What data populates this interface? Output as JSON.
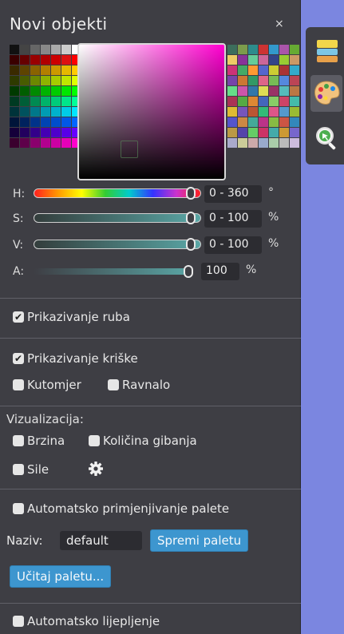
{
  "window": {
    "title": "Novi objekti",
    "close_glyph": "×"
  },
  "palette": {
    "left": [
      "#111111",
      "#444444",
      "#666666",
      "#888888",
      "#aaaaaa",
      "#cccccc",
      "#ffffff",
      "#3a0000",
      "#660000",
      "#990000",
      "#b00000",
      "#cc0000",
      "#dd1111",
      "#ff0000",
      "#3a2a00",
      "#5e4400",
      "#8a6300",
      "#b37f00",
      "#cc9900",
      "#e6b800",
      "#ffcc00",
      "#2e3a00",
      "#485c00",
      "#6b8800",
      "#8fb300",
      "#a6cc00",
      "#bfe600",
      "#ddff00",
      "#003a00",
      "#005e00",
      "#008a00",
      "#00b300",
      "#00cc00",
      "#00e600",
      "#00ff00",
      "#003a22",
      "#005e37",
      "#008a52",
      "#00b36a",
      "#00cc7a",
      "#00e68a",
      "#00ff99",
      "#00333a",
      "#00525e",
      "#00788a",
      "#009cb3",
      "#00b3cc",
      "#00cce6",
      "#00e6ff",
      "#00153a",
      "#00225e",
      "#00338a",
      "#0044b3",
      "#004ecc",
      "#0058e6",
      "#0066ff",
      "#15003a",
      "#22005e",
      "#33008a",
      "#4400b3",
      "#4e00cc",
      "#5800e6",
      "#6600ff",
      "#3a002e",
      "#5e004a",
      "#8a006d",
      "#b3008f",
      "#cc00a3",
      "#e600b8",
      "#ff00cc"
    ],
    "right": [
      "#3c6e5c",
      "#7c9c4c",
      "#2d8c8c",
      "#cc3333",
      "#3399cc",
      "#aa55aa",
      "#66aa33",
      "#eecc66",
      "#883399",
      "#66cc99",
      "#cc6699",
      "#334488",
      "#99cc33",
      "#cc9966",
      "#cc3377",
      "#44aa66",
      "#ff9933",
      "#5566cc",
      "#cccc33",
      "#aa3333",
      "#33aacc",
      "#7744aa",
      "#cc7733",
      "#339966",
      "#dd6688",
      "#77bb55",
      "#5588dd",
      "#bb4455",
      "#66dd88",
      "#cc55aa",
      "#3377aa",
      "#dddd55",
      "#993366",
      "#55bbbb",
      "#bb7744",
      "#aa3355",
      "#55aa44",
      "#dd8833",
      "#4466bb",
      "#88cc66",
      "#cc4466",
      "#44bbaa",
      "#ddbb33",
      "#7755bb",
      "#bb5533",
      "#33bb77",
      "#dd5588",
      "#5599cc",
      "#99bb33",
      "#5555cc",
      "#cc8844",
      "#44aa99",
      "#bb3388",
      "#88bb44",
      "#cc5544",
      "#3388bb",
      "#bb9944",
      "#5544aa",
      "#66cc66",
      "#cc3366",
      "#44aaaa",
      "#cc9933",
      "#7766cc",
      "#aaaacc",
      "#cccc99",
      "#ccaaaa",
      "#99aacc",
      "#aaccaa",
      "#bbbbbb",
      "#ccbbdd"
    ],
    "picker_hue_color": "#ff00d0"
  },
  "sliders": {
    "h": {
      "label": "H:",
      "range": "0 - 360",
      "unit": "°",
      "level": 0.97
    },
    "s": {
      "label": "S:",
      "range": "0 - 100",
      "unit": "%",
      "level": 0.97
    },
    "v": {
      "label": "V:",
      "range": "0 - 100",
      "unit": "%",
      "level": 0.97
    },
    "a": {
      "label": "A:",
      "value": "100",
      "unit": "%",
      "level": 1.0
    }
  },
  "options": {
    "show_border": {
      "label": "Prikazivanje ruba",
      "checked": true
    },
    "show_slice": {
      "label": "Prikazivanje kriške",
      "checked": true
    },
    "protractor": {
      "label": "Kutomjer",
      "checked": false
    },
    "ruler": {
      "label": "Ravnalo",
      "checked": false
    }
  },
  "visualization": {
    "title": "Vizualizacija:",
    "speed": {
      "label": "Brzina",
      "checked": false
    },
    "momentum": {
      "label": "Količina gibanja",
      "checked": false
    },
    "forces": {
      "label": "Sile",
      "checked": false
    },
    "settings_icon": "gear-icon"
  },
  "palette_section": {
    "auto_apply": {
      "label": "Automatsko primjenjivanje palete",
      "checked": false
    },
    "name_label": "Naziv:",
    "name_value": "default",
    "save_button": "Spremi paletu",
    "load_button": "Učitaj paletu..."
  },
  "auto_paste": {
    "label": "Automatsko lijepljenje",
    "checked": false
  },
  "side_tabs": [
    {
      "icon": "layers-icon",
      "active": false
    },
    {
      "icon": "palette-icon",
      "active": true
    },
    {
      "icon": "zoom-icon",
      "active": false
    }
  ],
  "colors": {
    "accent": "#3d96cf",
    "panel": "#3e3e44",
    "desktop": "#7b86e0"
  }
}
